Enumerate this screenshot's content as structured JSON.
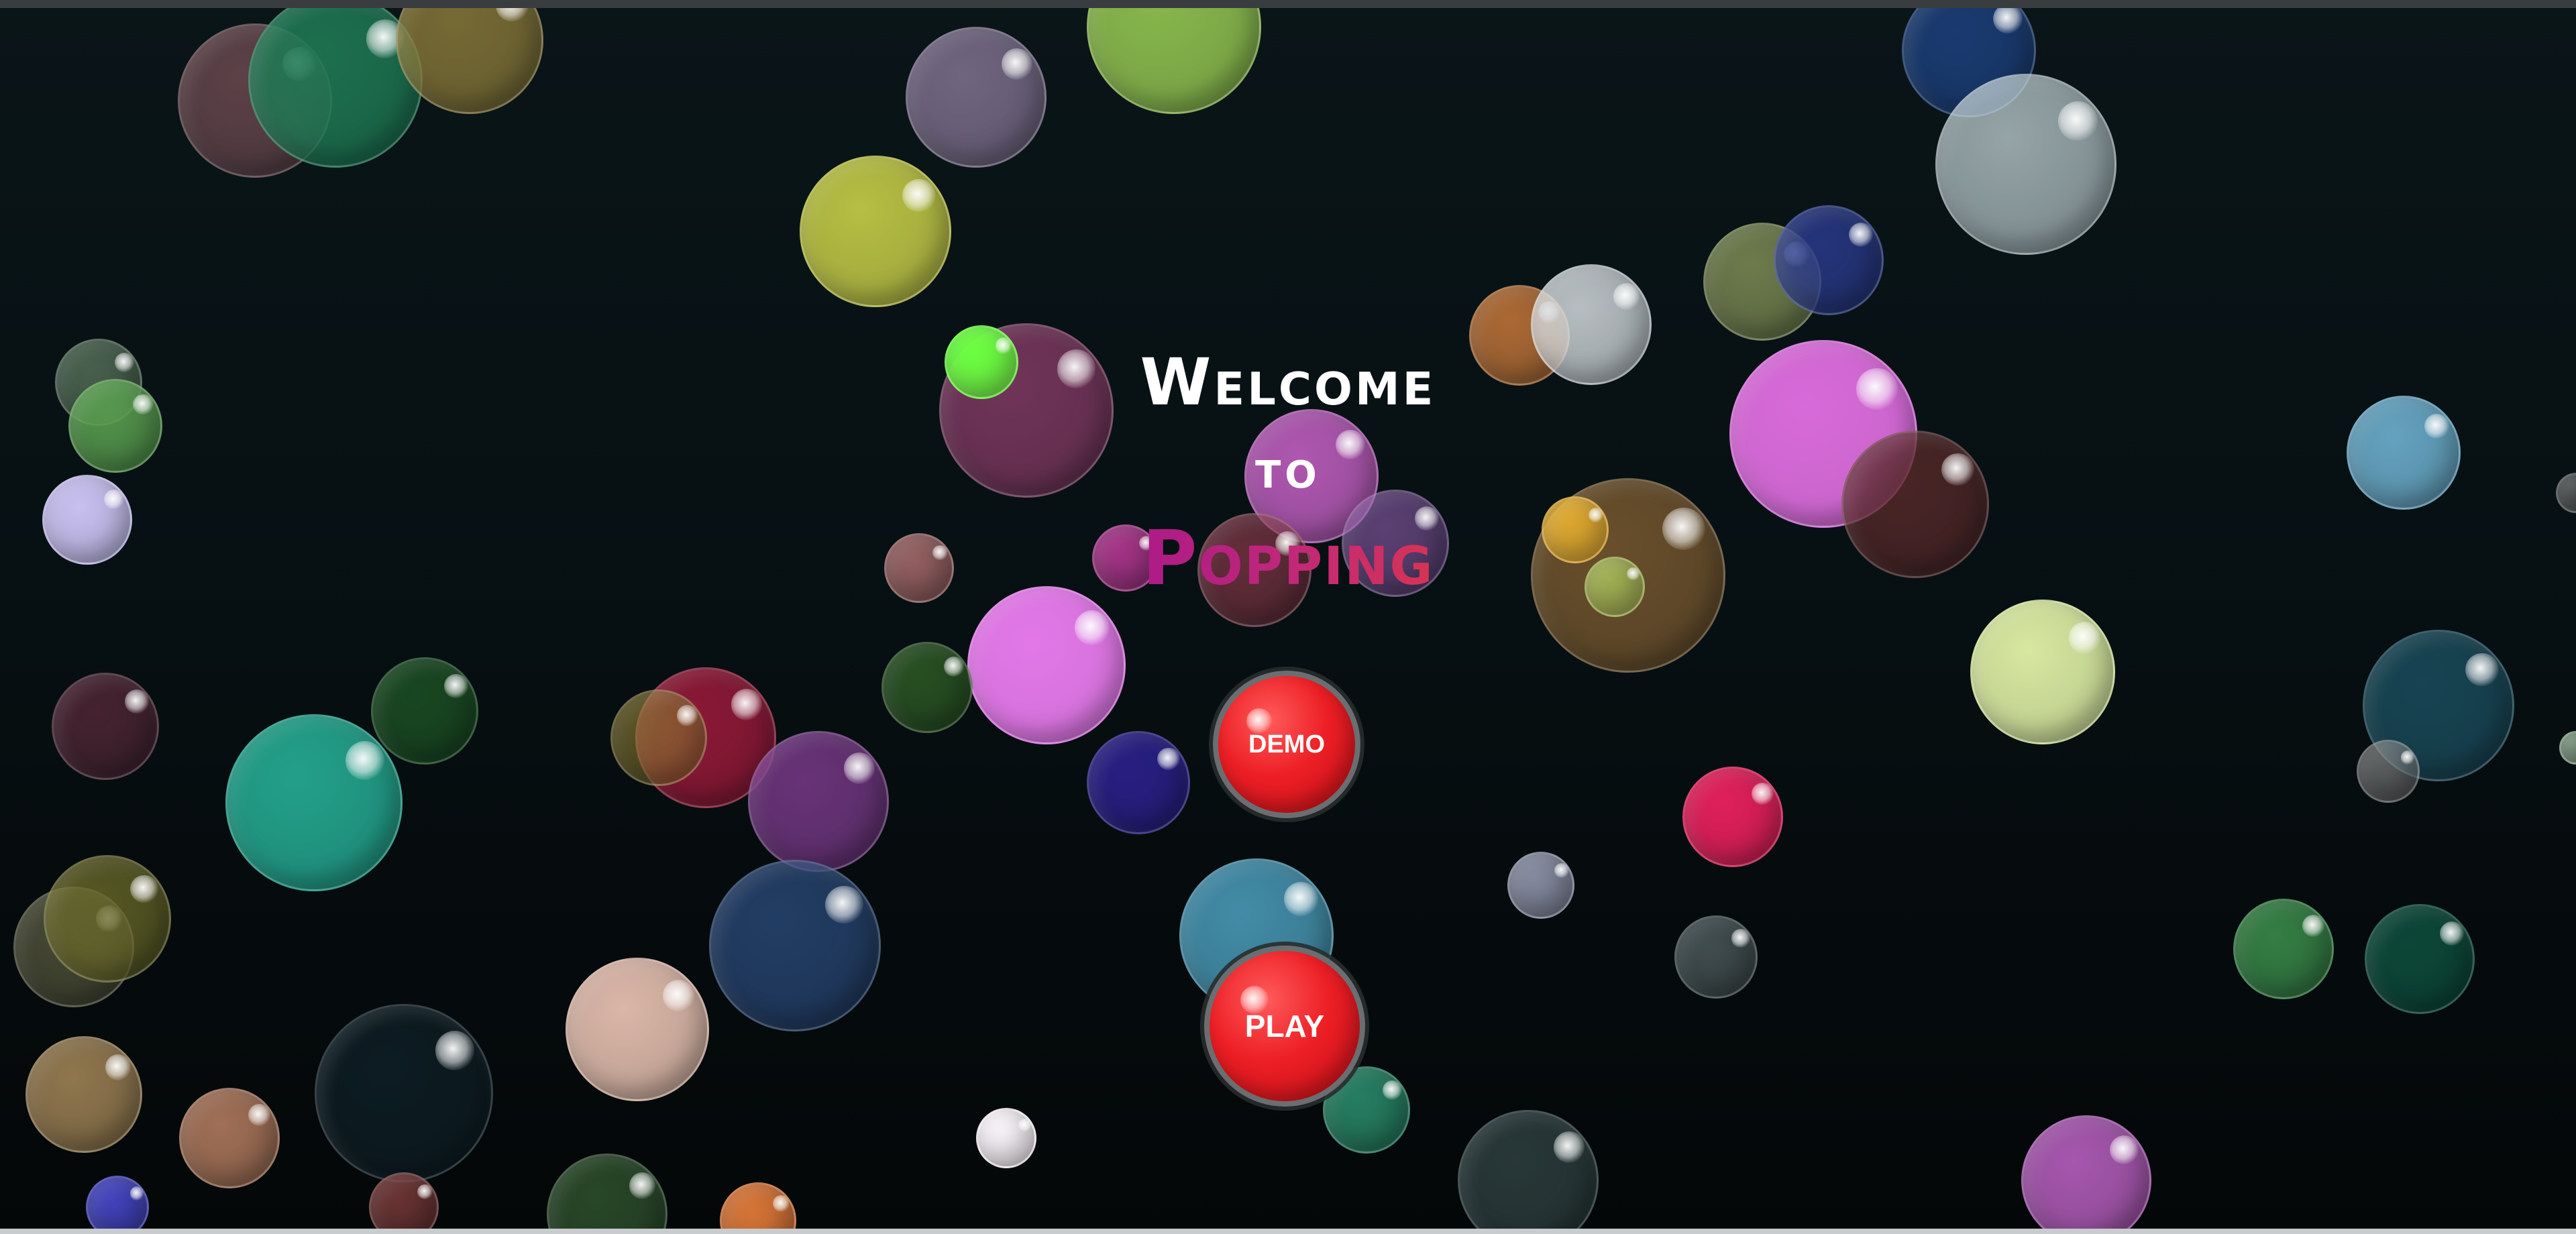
{
  "welcome": {
    "line1": "Welcome",
    "line2": "to",
    "line3": "Popping"
  },
  "buttons": {
    "demo_label": "DEMO",
    "play_label": "PLAY"
  },
  "colors": {
    "background": "#071114",
    "button_red": "#ec1f25",
    "title_gradient_start": "#a0128e",
    "title_gradient_end": "#e53b3b"
  }
}
